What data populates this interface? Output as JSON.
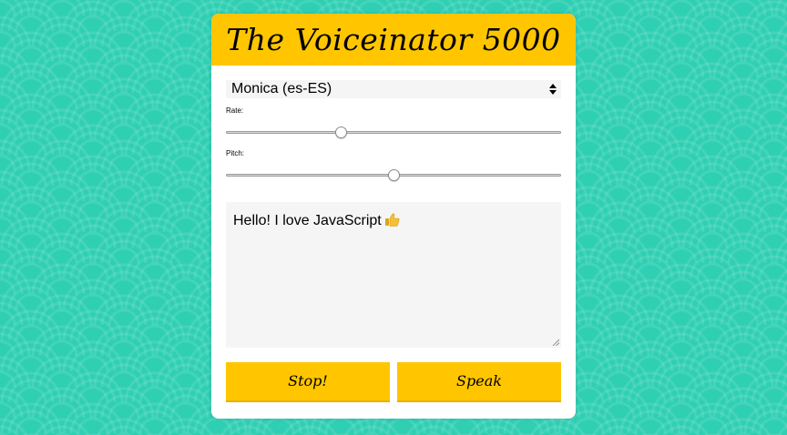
{
  "app": {
    "title": "The Voiceinator 5000"
  },
  "voice_select": {
    "selected": "Monica (es-ES)"
  },
  "rate": {
    "label": "Rate:",
    "value_fraction": 0.345
  },
  "pitch": {
    "label": "Pitch:",
    "value_fraction": 0.5
  },
  "message": {
    "text": "Hello! I love JavaScript",
    "emoji_icon": "thumbs-up-icon"
  },
  "buttons": {
    "stop_label": "Stop!",
    "speak_label": "Speak"
  },
  "colors": {
    "accent": "#ffc600",
    "background": "#2fcfb3"
  }
}
